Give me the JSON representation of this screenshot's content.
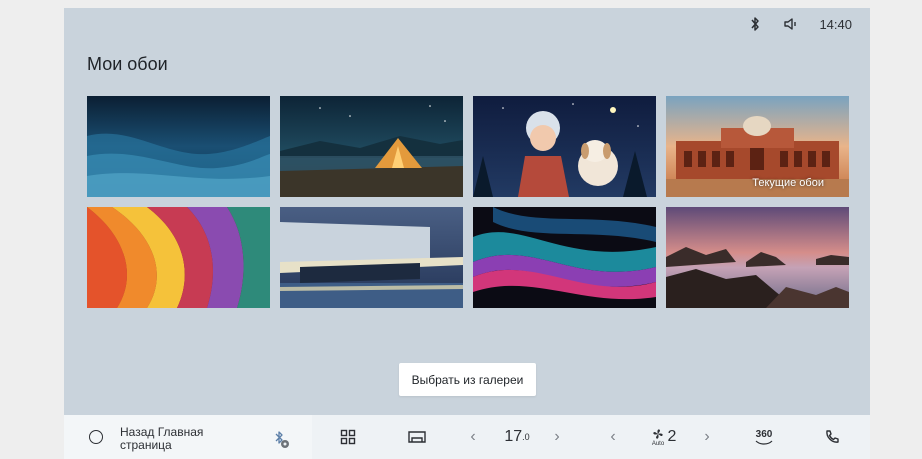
{
  "status": {
    "time": "14:40",
    "bluetooth_icon": "bluetooth-icon",
    "volume_icon": "volume-icon"
  },
  "page": {
    "title": "Мои обои"
  },
  "wallpapers": [
    {
      "name": "blue-waves",
      "label": ""
    },
    {
      "name": "tent-lake-night",
      "label": ""
    },
    {
      "name": "girl-and-puppy",
      "label": ""
    },
    {
      "name": "palace-sunset",
      "label": "Текущие обои"
    },
    {
      "name": "colorful-petals",
      "label": ""
    },
    {
      "name": "modern-building",
      "label": ""
    },
    {
      "name": "glossy-ribbons",
      "label": ""
    },
    {
      "name": "rocky-sea-sunset",
      "label": ""
    }
  ],
  "gallery_button": "Выбрать из галереи",
  "dock": {
    "back_home": "Назад Главная страница",
    "temperature_main": "17",
    "temperature_decimal": ".0",
    "fan_level": "2",
    "fan_mode": "Auto",
    "camera_360": "360",
    "icons": [
      "circle-icon",
      "bluetooth-badge-icon",
      "apps-grid-icon",
      "car-seat-icon",
      "chevron-left-icon",
      "chevron-right-icon",
      "fan-icon",
      "camera-360-icon",
      "phone-icon"
    ]
  }
}
